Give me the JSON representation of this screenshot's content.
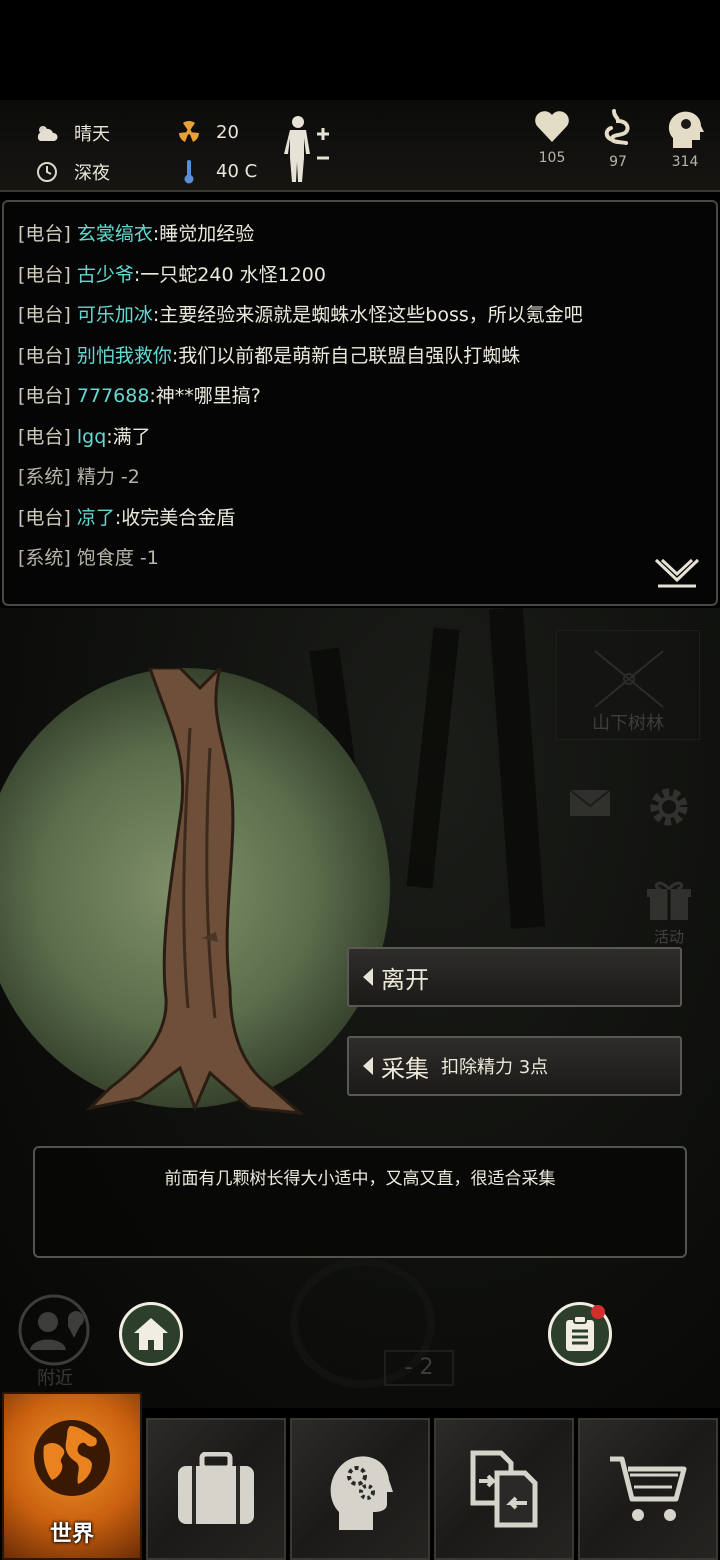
{
  "status": {
    "weather": "晴天",
    "time_of_day": "深夜",
    "radiation": "20",
    "temperature": "40 C",
    "vitals": [
      {
        "name": "health",
        "icon": "heart-icon",
        "value": "105"
      },
      {
        "name": "stomach",
        "icon": "stomach-icon",
        "value": "97"
      },
      {
        "name": "mind",
        "icon": "mind-icon",
        "value": "314"
      }
    ]
  },
  "chat": {
    "messages": [
      {
        "tag": "[电台]",
        "name": "玄裳缟衣",
        "text": ":睡觉加经验"
      },
      {
        "tag": "[电台]",
        "name": "古少爷",
        "text": ":一只蛇240 水怪1200"
      },
      {
        "tag": "[电台]",
        "name": "可乐加冰",
        "text": ":主要经验来源就是蜘蛛水怪这些boss，所以氪金吧"
      },
      {
        "tag": "[电台]",
        "name": "别怕我救你",
        "text": ":我们以前都是萌新自己联盟自强队打蜘蛛"
      },
      {
        "tag": "[电台]",
        "name": "777688",
        "text": ":神**哪里搞?"
      },
      {
        "tag": "[电台]",
        "name": "lgq",
        "text": ":满了"
      },
      {
        "tag": "[系统]",
        "name": "",
        "text": "精力 -2"
      },
      {
        "tag": "[电台]",
        "name": "凉了",
        "text": ":收完美合金盾"
      },
      {
        "tag": "[系统]",
        "name": "",
        "text": "饱食度 -1"
      }
    ]
  },
  "scene": {
    "location": "山下树林",
    "gift_label": "活动",
    "actions": [
      {
        "label": "离开",
        "sub": ""
      },
      {
        "label": "采集",
        "sub": "扣除精力 3点"
      }
    ],
    "description": "前面有几颗树长得大小适中，又高又直，很适合采集",
    "nearby_label": "附近",
    "compass_value": "- 2"
  },
  "nav": {
    "world_label": "世界"
  },
  "colors": {
    "accent_cyan": "#63d9d0",
    "nav_active": "#e8801d",
    "badge_red": "#d12e2e"
  }
}
